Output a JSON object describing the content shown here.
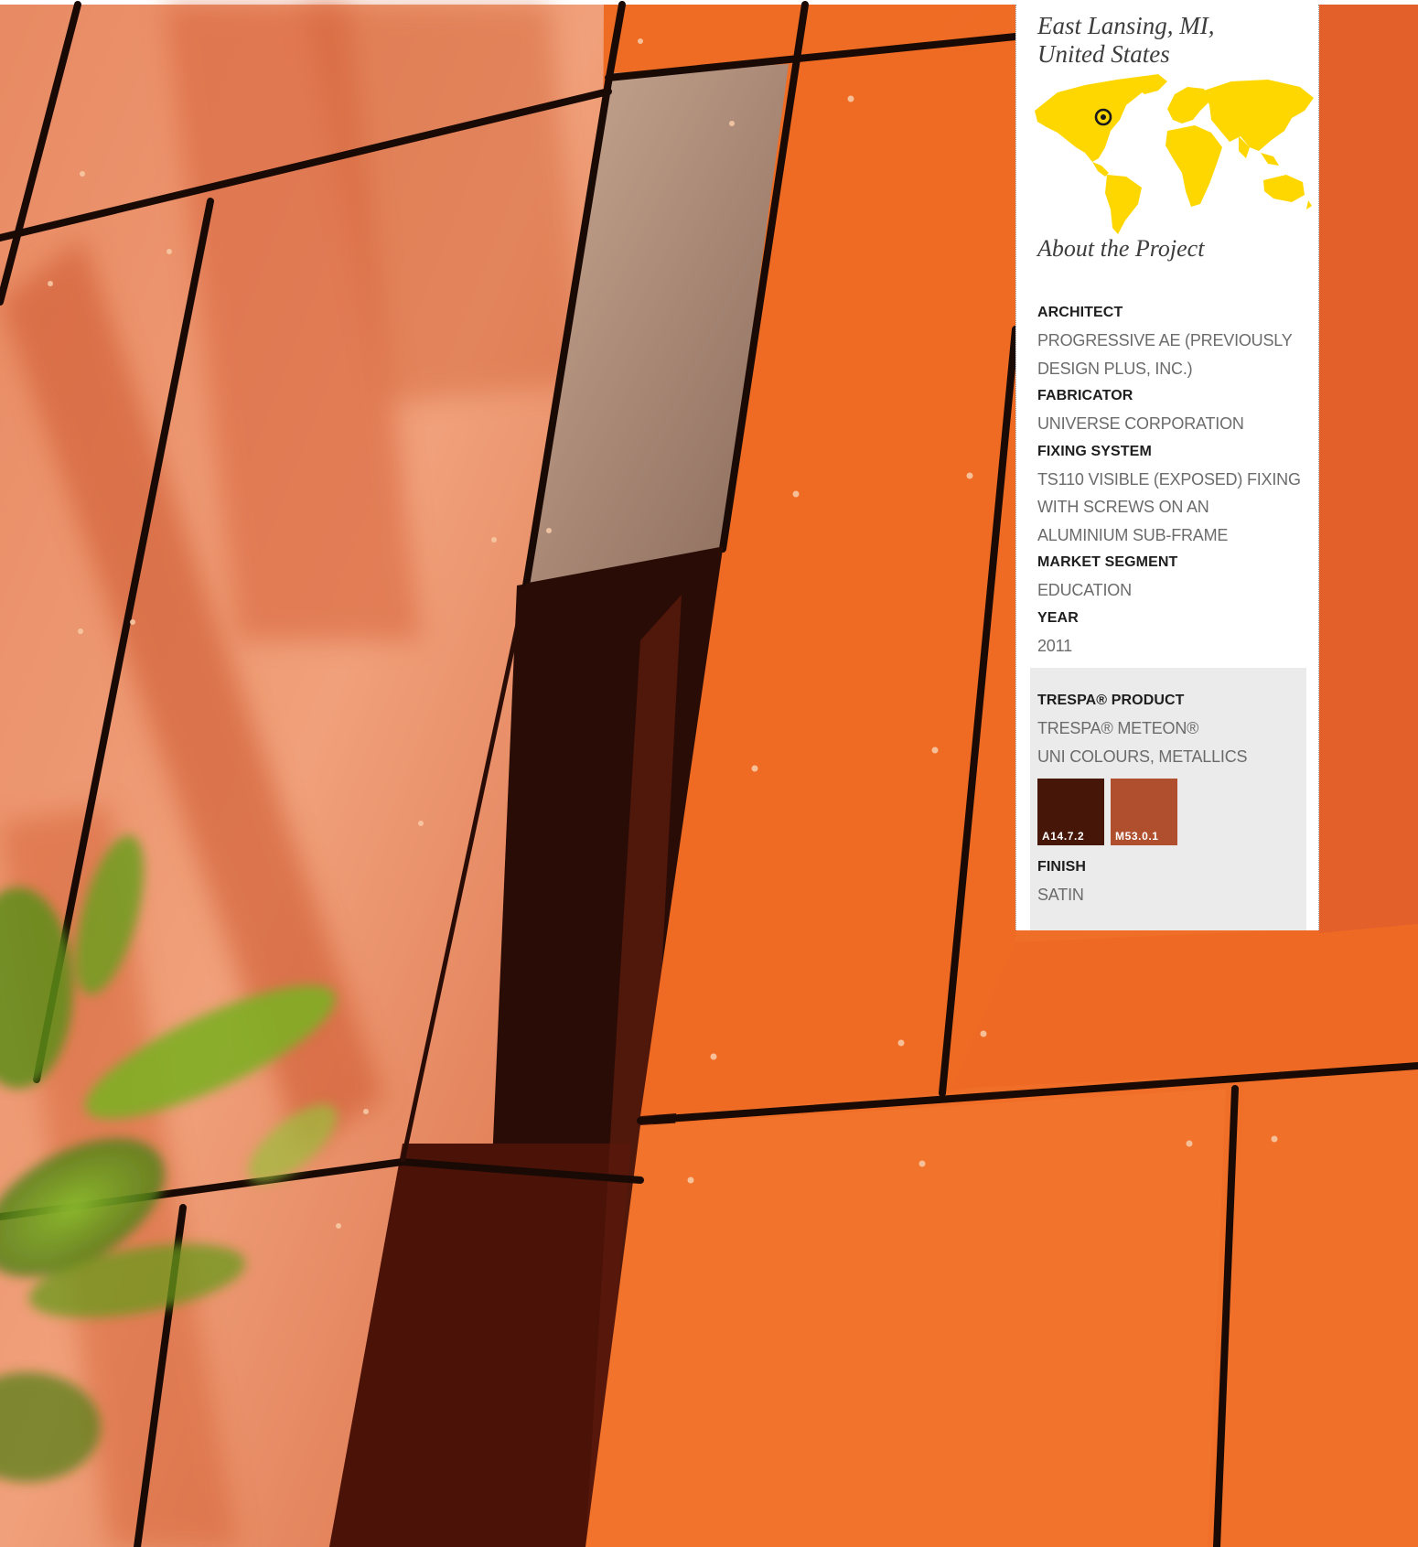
{
  "location": {
    "city": "East Lansing, MI,",
    "country": "United States"
  },
  "map": {
    "land_color": "#FFD700",
    "marker_icon": "location-target-icon"
  },
  "about_title": "About the Project",
  "specs": [
    {
      "label": "ARCHITECT",
      "value": "PROGRESSIVE AE (PREVIOUSLY DESIGN PLUS, INC.)"
    },
    {
      "label": "FABRICATOR",
      "value": "UNIVERSE CORPORATION"
    },
    {
      "label": "FIXING SYSTEM",
      "value": "TS110 VISIBLE (EXPOSED) FIXING WITH SCREWS ON AN ALUMINIUM SUB-FRAME"
    },
    {
      "label": "MARKET SEGMENT",
      "value": "EDUCATION"
    },
    {
      "label": "YEAR",
      "value": "2011"
    }
  ],
  "product": {
    "label": "TRESPA® PRODUCT",
    "line1": "TRESPA® METEON®",
    "line2": "UNI COLOURS, METALLICS",
    "swatches": [
      {
        "code": "A14.7.2",
        "color": "#461608"
      },
      {
        "code": "M53.0.1",
        "color": "#b04f2e"
      }
    ],
    "finish_label": "FINISH",
    "finish_value": "SATIN"
  }
}
